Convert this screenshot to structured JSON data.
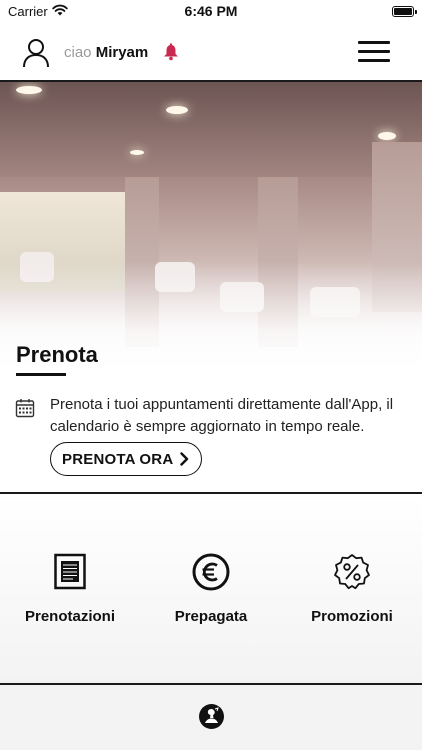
{
  "status_bar": {
    "carrier": "Carrier",
    "time": "6:46 PM"
  },
  "header": {
    "greeting_prefix": "ciao",
    "user_name": "Miryam",
    "accent_color": "#c8294f"
  },
  "hero": {
    "section_title": "Prenota",
    "description": "Prenota i tuoi appuntamenti direttamente dall'App, il calendario è sempre aggiornato in tempo reale.",
    "cta_label": "PRENOTA ORA"
  },
  "features": [
    {
      "label": "Prenotazioni",
      "icon": "document-icon"
    },
    {
      "label": "Prepagata",
      "icon": "euro-icon"
    },
    {
      "label": "Promozioni",
      "icon": "discount-badge-icon"
    }
  ]
}
